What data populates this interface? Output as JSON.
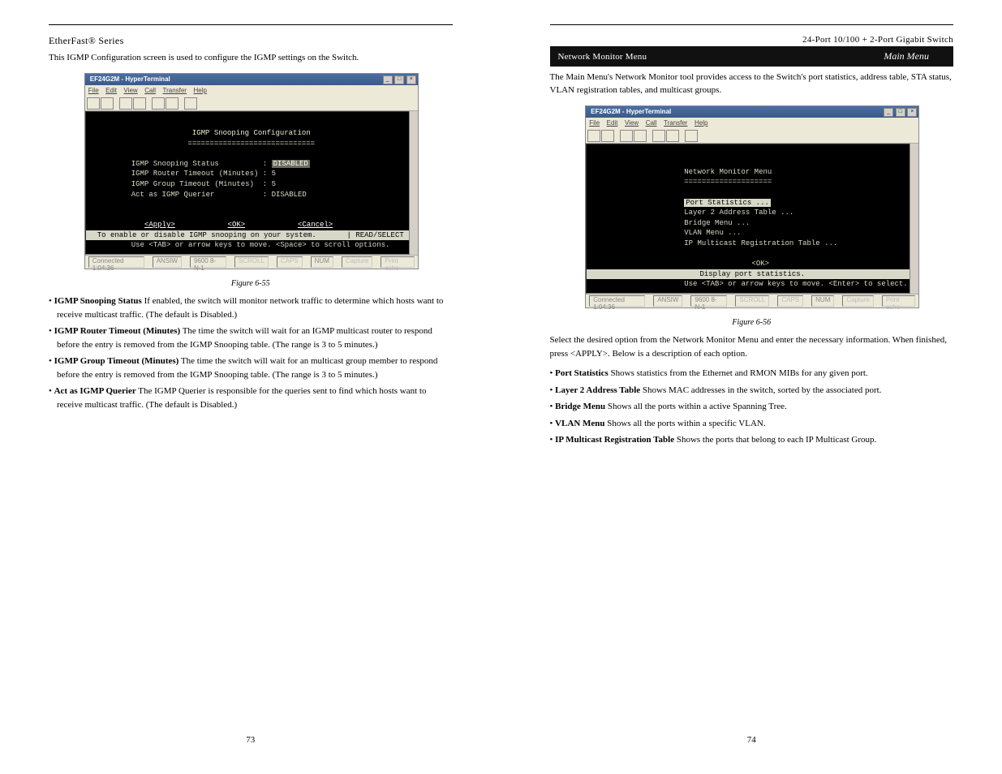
{
  "left_page": {
    "header_product": "EtherFast® Series",
    "intro": "This IGMP Configuration screen is used to configure the IGMP settings on the Switch.",
    "window": {
      "title": "EF24G2M - HyperTerminal",
      "menus": [
        "File",
        "Edit",
        "View",
        "Call",
        "Transfer",
        "Help"
      ],
      "terminal_title": "IGMP Snooping Configuration",
      "terminal_rule": "=============================",
      "rows": [
        {
          "label": "IGMP Snooping Status",
          "value": "DISABLED"
        },
        {
          "label": "IGMP Router Timeout (Minutes)",
          "value": "5"
        },
        {
          "label": "IGMP Group Timeout (Minutes)",
          "value": "5"
        },
        {
          "label": "Act as IGMP Querier",
          "value": "DISABLED"
        }
      ],
      "buttons": [
        "<Apply>",
        "<OK>",
        "<Cancel>"
      ],
      "helpline": "To enable or disable IGMP snooping on your system.",
      "tag": "| READ/SELECT",
      "nav": "Use <TAB> or arrow keys to move. <Space> to scroll options.",
      "status": [
        "Connected 1:04:36",
        "ANSIW",
        "9600 8-N-1",
        "SCROLL",
        "CAPS",
        "NUM",
        "Capture",
        "Print echo"
      ]
    },
    "fig_caption": "Figure 6-55",
    "def_items": [
      {
        "term": "IGMP Snooping Status",
        "desc": "If enabled, the switch will monitor network traffic to determine which hosts want to receive multicast traffic. (The default is Disabled.)"
      },
      {
        "term": "IGMP Router Timeout (Minutes)",
        "desc": "The time the switch will wait for an IGMP multicast router to respond before the entry is removed from the IGMP Snooping table. (The range is 3 to 5 minutes.)"
      },
      {
        "term": "IGMP Group Timeout (Minutes)",
        "desc": "The time the switch will wait for an multicast group member to respond before the entry is removed from the IGMP Snooping table. (The range is 3 to 5 minutes.)"
      },
      {
        "term": "Act as IGMP Querier",
        "desc": "The IGMP Querier is responsible for the queries sent to find which hosts want to receive multicast traffic. (The default is Disabled.)"
      }
    ],
    "page_number": "73"
  },
  "right_page": {
    "header_product": "24-Port 10/100 + 2-Port Gigabit Switch",
    "section_heading": "Network Monitor Menu",
    "section_sub": "Main Menu",
    "intro": "The Main Menu's Network Monitor tool provides access to the Switch's port statistics, address table, STA status, VLAN registration tables, and multicast groups.",
    "window": {
      "title": "EF24G2M - HyperTerminal",
      "menus": [
        "File",
        "Edit",
        "View",
        "Call",
        "Transfer",
        "Help"
      ],
      "terminal_title": "Network Monitor Menu",
      "terminal_rule": "====================",
      "menu_items": [
        "Port Statistics ...",
        "Layer 2 Address Table ...",
        "Bridge Menu ...",
        "VLAN Menu ...",
        "IP Multicast Registration Table ..."
      ],
      "ok": "<OK>",
      "help": "Display port statistics.",
      "nav": "Use <TAB> or arrow keys to move. <Enter> to select.",
      "status": [
        "Connected 1:04:36",
        "ANSIW",
        "9600 8-N-1",
        "SCROLL",
        "CAPS",
        "NUM",
        "Capture",
        "Print echo"
      ]
    },
    "fig_caption": "Figure 6-56",
    "body_paragraph": "Select the desired option from the Network Monitor Menu and enter the necessary information. When finished, press <APPLY>. Below is a description of each option.",
    "def_items": [
      {
        "term": "Port Statistics",
        "desc": "Shows statistics from the Ethernet and RMON MIBs for any given port."
      },
      {
        "term": "Layer 2 Address Table",
        "desc": "Shows MAC addresses in the switch, sorted by the associated port."
      },
      {
        "term": "Bridge Menu",
        "desc": "Shows all the ports within a active Spanning Tree."
      },
      {
        "term": "VLAN Menu",
        "desc": "Shows all the ports within a specific VLAN."
      },
      {
        "term": "IP Multicast Registration Table",
        "desc": "Shows the ports that belong to each IP Multicast Group."
      }
    ],
    "page_number": "74"
  }
}
